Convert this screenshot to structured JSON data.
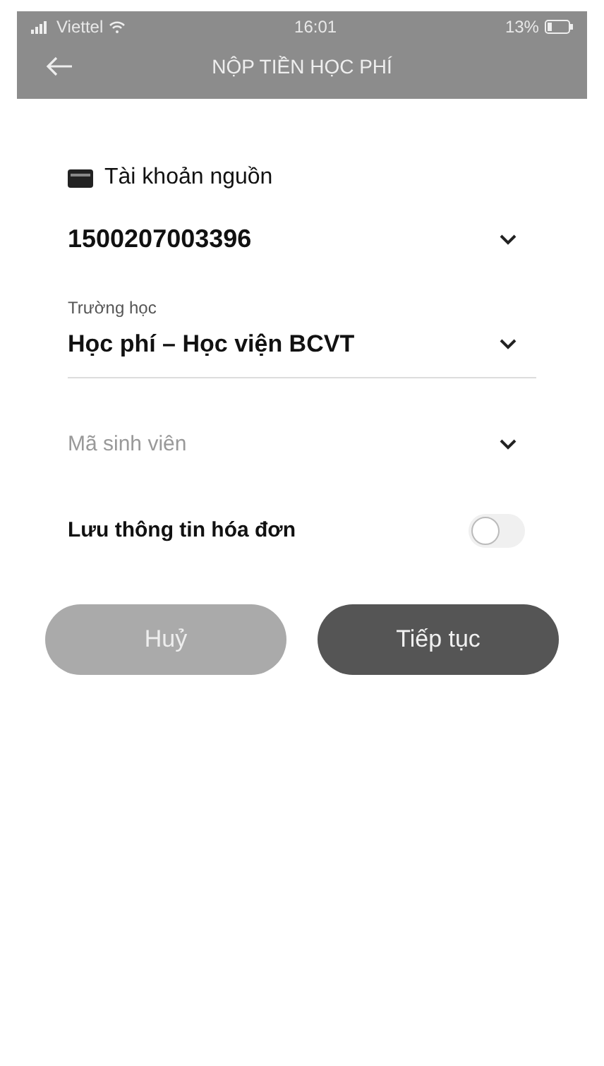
{
  "status_bar": {
    "carrier": "Viettel",
    "time": "16:01",
    "battery": "13%"
  },
  "header": {
    "title": "NỘP TIỀN HỌC PHÍ"
  },
  "source_account": {
    "label": "Tài khoản nguồn",
    "value": "1500207003396"
  },
  "school": {
    "label": "Trường học",
    "value": "Học phí – Học viện BCVT"
  },
  "student_id": {
    "placeholder": "Mã sinh viên"
  },
  "save_invoice": {
    "label": "Lưu thông tin hóa đơn",
    "on": false
  },
  "buttons": [
    {
      "label": "Huỷ",
      "kind": "secondary"
    },
    {
      "label": "Tiếp tục",
      "kind": "primary"
    }
  ]
}
